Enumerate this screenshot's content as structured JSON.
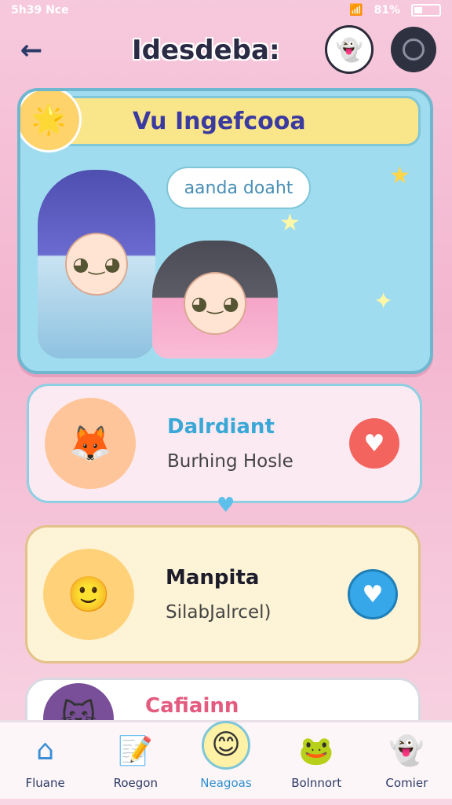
{
  "status": {
    "left": "5h39 Nce",
    "battery": "81%"
  },
  "header": {
    "title": "Idesdeba:",
    "back_icon": "arrow-left-icon",
    "mascot_icon": "ghost-mascot-icon",
    "menu_icon": "circle-menu-icon"
  },
  "hero": {
    "banner": "Vu Ingefcooa",
    "speech": "aanda doaht"
  },
  "cards": [
    {
      "name": "Dalrdiant",
      "subtitle": "Burhing Hosle",
      "heart_color": "#f4645f"
    },
    {
      "name": "Manpita",
      "subtitle": "SilabJalrcel)",
      "heart_color": "#36a7e8"
    },
    {
      "name": "Cafiainn",
      "subtitle": ""
    }
  ],
  "tabs": [
    {
      "label": "Fluane",
      "icon": "home-icon"
    },
    {
      "label": "Roegon",
      "icon": "pencil-note-icon"
    },
    {
      "label": "Neagoas",
      "icon": "smiley-bee-icon",
      "active": true
    },
    {
      "label": "Bolnnort",
      "icon": "frog-icon"
    },
    {
      "label": "Comier",
      "icon": "ghost-icon"
    }
  ]
}
